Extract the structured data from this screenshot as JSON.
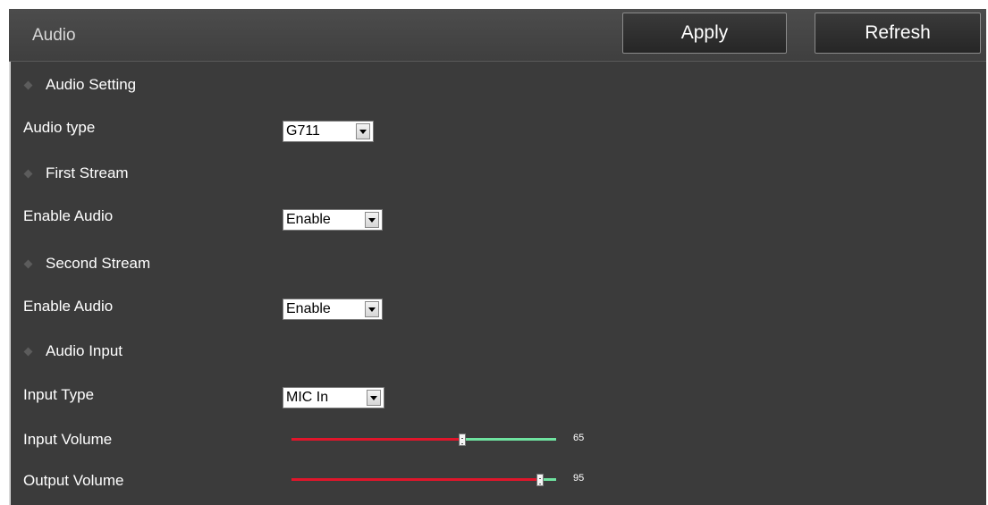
{
  "header": {
    "title": "Audio",
    "apply_label": "Apply",
    "refresh_label": "Refresh"
  },
  "sections": {
    "audio_setting": "Audio Setting",
    "first_stream": "First Stream",
    "second_stream": "Second Stream",
    "audio_input": "Audio Input"
  },
  "fields": {
    "audio_type": {
      "label": "Audio type",
      "value": "G711"
    },
    "first_enable_audio": {
      "label": "Enable Audio",
      "value": "Enable"
    },
    "second_enable_audio": {
      "label": "Enable Audio",
      "value": "Enable"
    },
    "input_type": {
      "label": "Input Type",
      "value": "MIC In"
    },
    "input_volume": {
      "label": "Input Volume",
      "value": "65",
      "level": 65
    },
    "output_volume": {
      "label": "Output Volume",
      "value": "95",
      "level": 95
    }
  },
  "colors": {
    "slider_filled": "#e0162b",
    "slider_remaining": "#6fe3a0",
    "panel_bg": "#3b3b3b"
  }
}
